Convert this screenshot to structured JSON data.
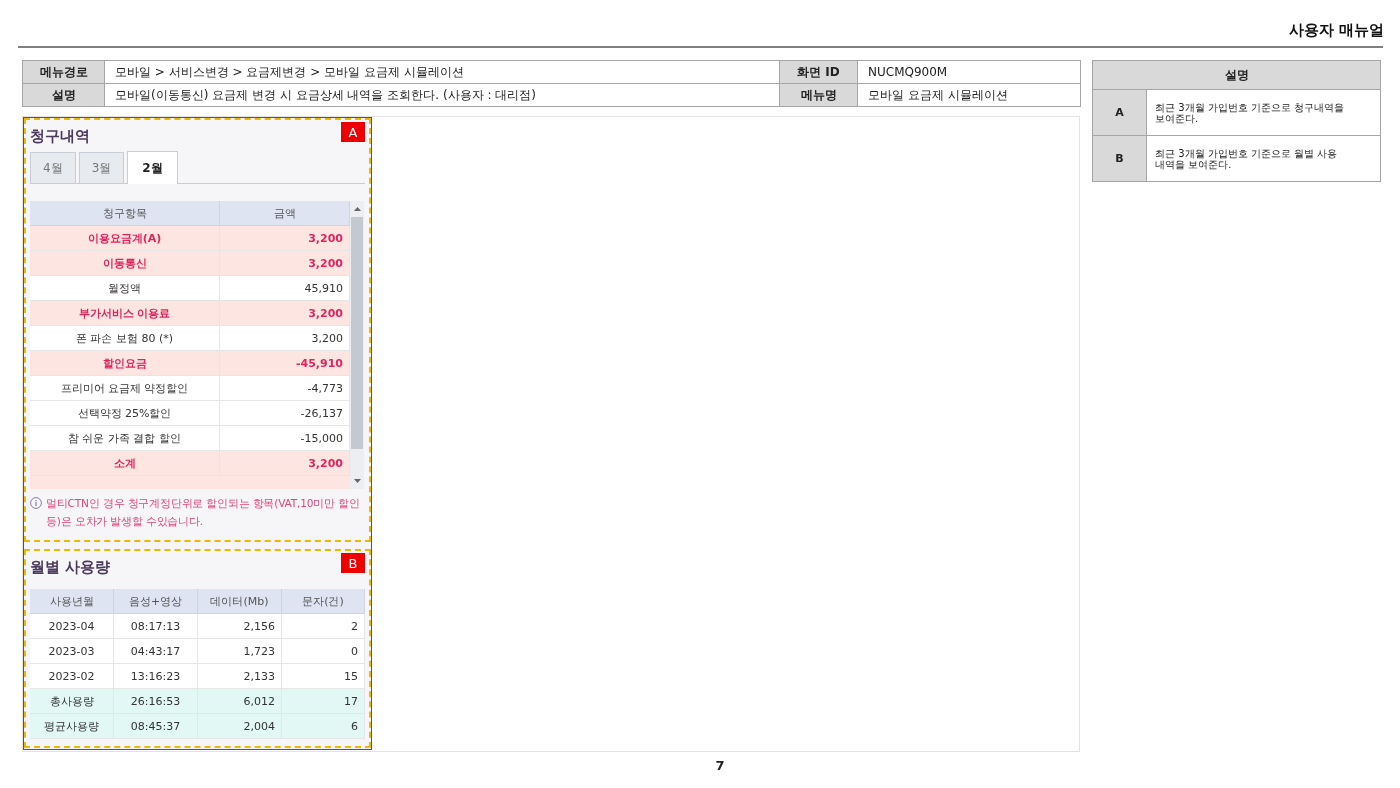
{
  "header": {
    "title": "사용자 매뉴얼"
  },
  "info_table": {
    "rows": [
      {
        "label": "메뉴경로",
        "value": "모바일 > 서비스변경 > 요금제변경 > 모바일 요금제 시뮬레이션",
        "label_2": "화면 ID",
        "value_2": "NUCMQ900M"
      },
      {
        "label": "설명",
        "value": "모바일(이동통신) 요금제 변경 시 요금상세 내역을 조회한다. (사용자 : 대리점)",
        "label_2": "메뉴명",
        "value_2": "모바일 요금제 시뮬레이션"
      }
    ]
  },
  "billing_panel": {
    "badge": "A",
    "title": "청구내역",
    "tabs": [
      {
        "label": "4월",
        "selected": false
      },
      {
        "label": "3월",
        "selected": false
      },
      {
        "label": "2월",
        "selected": true
      }
    ],
    "table": {
      "columns": [
        "청구항목",
        "금액"
      ],
      "rows": [
        {
          "kind": "subtotal",
          "item": "이용요금계(A)",
          "amount": "3,200"
        },
        {
          "kind": "subtotal",
          "item": "이동통신",
          "amount": "3,200"
        },
        {
          "kind": "item",
          "item": "월정액",
          "amount": "45,910"
        },
        {
          "kind": "subtotal",
          "item": "부가서비스 이용료",
          "amount": "3,200"
        },
        {
          "kind": "item",
          "item": "폰 파손 보험 80 (*)",
          "amount": "3,200"
        },
        {
          "kind": "subtotal",
          "item": "할인요금",
          "amount": "-45,910"
        },
        {
          "kind": "item",
          "item": "프리미어 요금제 약정할인",
          "amount": "-4,773"
        },
        {
          "kind": "item",
          "item": "선택약정 25%할인",
          "amount": "-26,137"
        },
        {
          "kind": "item",
          "item": "참 쉬운 가족 결합 할인",
          "amount": "-15,000"
        },
        {
          "kind": "subtotal",
          "item": "소계",
          "amount": "3,200"
        }
      ]
    },
    "notice": "멀티CTN인 경우 청구계정단위로 할인되는 항목(VAT,10미만 할인등)은 오차가 발생할 수있습니다."
  },
  "usage_panel": {
    "badge": "B",
    "title": "월별 사용량",
    "table": {
      "columns": [
        "사용년월",
        "음성+영상",
        "데이터(Mb)",
        "문자(건)"
      ],
      "rows": [
        {
          "kind": "month",
          "cells": [
            "2023-04",
            "08:17:13",
            "2,156",
            "2"
          ]
        },
        {
          "kind": "month",
          "cells": [
            "2023-03",
            "04:43:17",
            "1,723",
            "0"
          ]
        },
        {
          "kind": "month",
          "cells": [
            "2023-02",
            "13:16:23",
            "2,133",
            "15"
          ]
        },
        {
          "kind": "summary",
          "cells": [
            "총사용량",
            "26:16:53",
            "6,012",
            "17"
          ]
        },
        {
          "kind": "summary",
          "cells": [
            "평균사용량",
            "08:45:37",
            "2,004",
            "6"
          ]
        }
      ]
    }
  },
  "description_table": {
    "heading": "설명",
    "rows": [
      {
        "marker": "A",
        "text": "최근 3개월 가입번호 기준으로 청구내역을 보여준다."
      },
      {
        "marker": "B",
        "text": "최근 3개월 가입번호 기준으로 월별 사용 내역을 보여준다."
      }
    ]
  },
  "page_number": "7"
}
